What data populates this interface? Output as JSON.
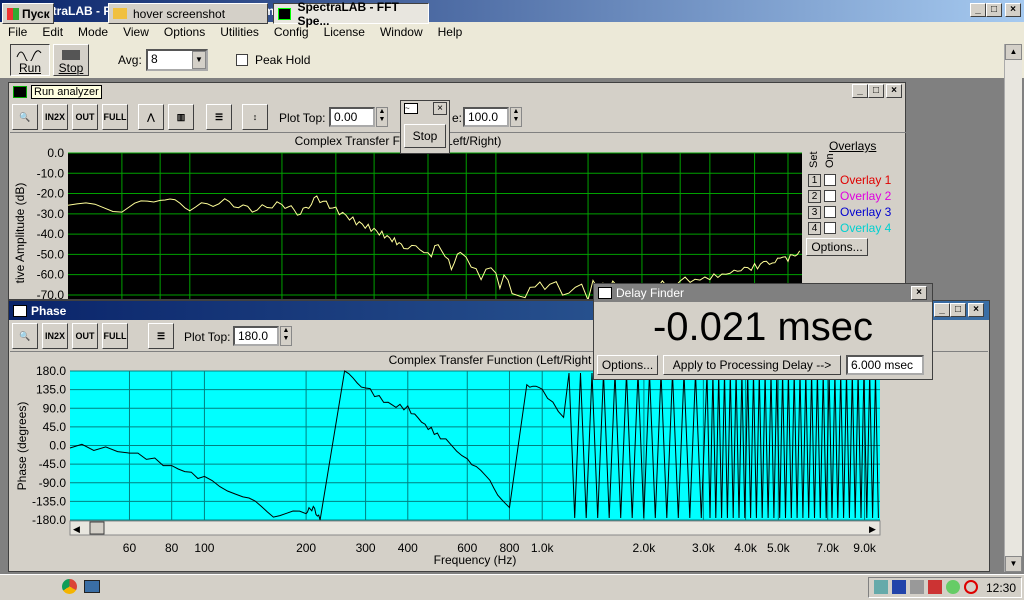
{
  "app": {
    "title": "SpectraLAB - FFT Spectral Analysis System",
    "menu": [
      "File",
      "Edit",
      "Mode",
      "View",
      "Options",
      "Utilities",
      "Config",
      "License",
      "Window",
      "Help"
    ],
    "run_label": "Run",
    "stop_label": "Stop",
    "avg_label": "Avg:",
    "avg_value": "8",
    "peak_hold_label": "Peak Hold"
  },
  "amp_window": {
    "title": "Run analyzer",
    "plot_top_label": "Plot Top:",
    "plot_top_value": "0.00",
    "plot_range_value": "100.0",
    "range_partial_label": "e:",
    "chart_title": "Complex Transfer Function (Left/Right)",
    "ylabel": "tive Amplitude (dB)",
    "overlays": {
      "heading": "Overlays",
      "set_label": "Set",
      "on_label": "On",
      "items": [
        {
          "num": "1",
          "label": "Overlay 1",
          "color": "#e00000"
        },
        {
          "num": "2",
          "label": "Overlay 2",
          "color": "#e000e0"
        },
        {
          "num": "3",
          "label": "Overlay 3",
          "color": "#0000d0"
        },
        {
          "num": "4",
          "label": "Overlay 4",
          "color": "#00d0d0"
        }
      ],
      "options_label": "Options..."
    }
  },
  "stop_popup": {
    "button_label": "Stop"
  },
  "phase_window": {
    "title": "Phase",
    "plot_top_label": "Plot Top:",
    "plot_top_value": "180.0",
    "chart_title": "Complex Transfer Function (Left/Right",
    "ylabel": "Phase (degrees)",
    "xlabel": "Frequency (Hz)"
  },
  "delay_finder": {
    "title": "Delay Finder",
    "readout": "-0.021 msec",
    "options_label": "Options...",
    "apply_label": "Apply to Processing Delay -->",
    "delay_value": "6.000 msec"
  },
  "taskbar": {
    "start_label": "Пуск",
    "tasks": [
      "hover screenshot",
      "SpectraLAB - FFT Spe..."
    ],
    "clock": "12:30"
  },
  "colors": {
    "amp_bg": "#000000",
    "amp_grid": "#00a000",
    "amp_trace": "#ffff99",
    "phase_bg": "#00ffff",
    "phase_grid": "#008080",
    "phase_trace": "#000000"
  },
  "chart_data": [
    {
      "type": "line",
      "title": "Complex Transfer Function (Left/Right)",
      "ylabel": "tive Amplitude (dB)",
      "yticks": [
        "0.0",
        "-10.0",
        "-20.0",
        "-30.0",
        "-40.0",
        "-50.0",
        "-60.0",
        "-70.0"
      ],
      "ylim": [
        -72,
        0
      ],
      "series": [
        {
          "x": [
            40,
            60,
            80,
            100,
            130,
            160,
            200,
            230,
            260,
            300,
            350,
            400,
            450,
            500,
            600,
            700,
            800,
            1000,
            1200,
            1500,
            2000,
            2500,
            3000,
            3500,
            4000,
            5000,
            6000,
            7000,
            8000,
            9000,
            10000
          ],
          "values": [
            -25,
            -28,
            -22,
            -27,
            -24,
            -28,
            -25,
            -30,
            -22,
            -28,
            -34,
            -38,
            -42,
            -46,
            -48,
            -52,
            -55,
            -62,
            -66,
            -68,
            -68,
            -67,
            -66,
            -64,
            -63,
            -61,
            -58,
            -56,
            -54,
            -52,
            -49
          ]
        }
      ]
    },
    {
      "type": "line",
      "title": "Complex Transfer Function (Left/Right",
      "ylabel": "Phase (degrees)",
      "xlabel": "Frequency (Hz)",
      "yticks": [
        "180.0",
        "135.0",
        "90.0",
        "45.0",
        "0.0",
        "-45.0",
        "-90.0",
        "-135.0",
        "-180.0"
      ],
      "ylim": [
        -180,
        180
      ],
      "xticks": [
        "60",
        "80",
        "100",
        "200",
        "300",
        "400",
        "600",
        "800",
        "1.0k",
        "2.0k",
        "3.0k",
        "4.0k",
        "5.0k",
        "7.0k",
        "9.0k"
      ],
      "series": [
        {
          "x": [
            40,
            60,
            80,
            100,
            130,
            160,
            200,
            210,
            220,
            260,
            300,
            350,
            400,
            450,
            500,
            600,
            700,
            800,
            900,
            1000,
            1200
          ],
          "values": [
            0,
            -15,
            -50,
            -80,
            -120,
            -170,
            -160,
            -150,
            -180,
            175,
            140,
            100,
            90,
            50,
            20,
            -30,
            -90,
            -150,
            150,
            130,
            60
          ]
        }
      ]
    }
  ]
}
